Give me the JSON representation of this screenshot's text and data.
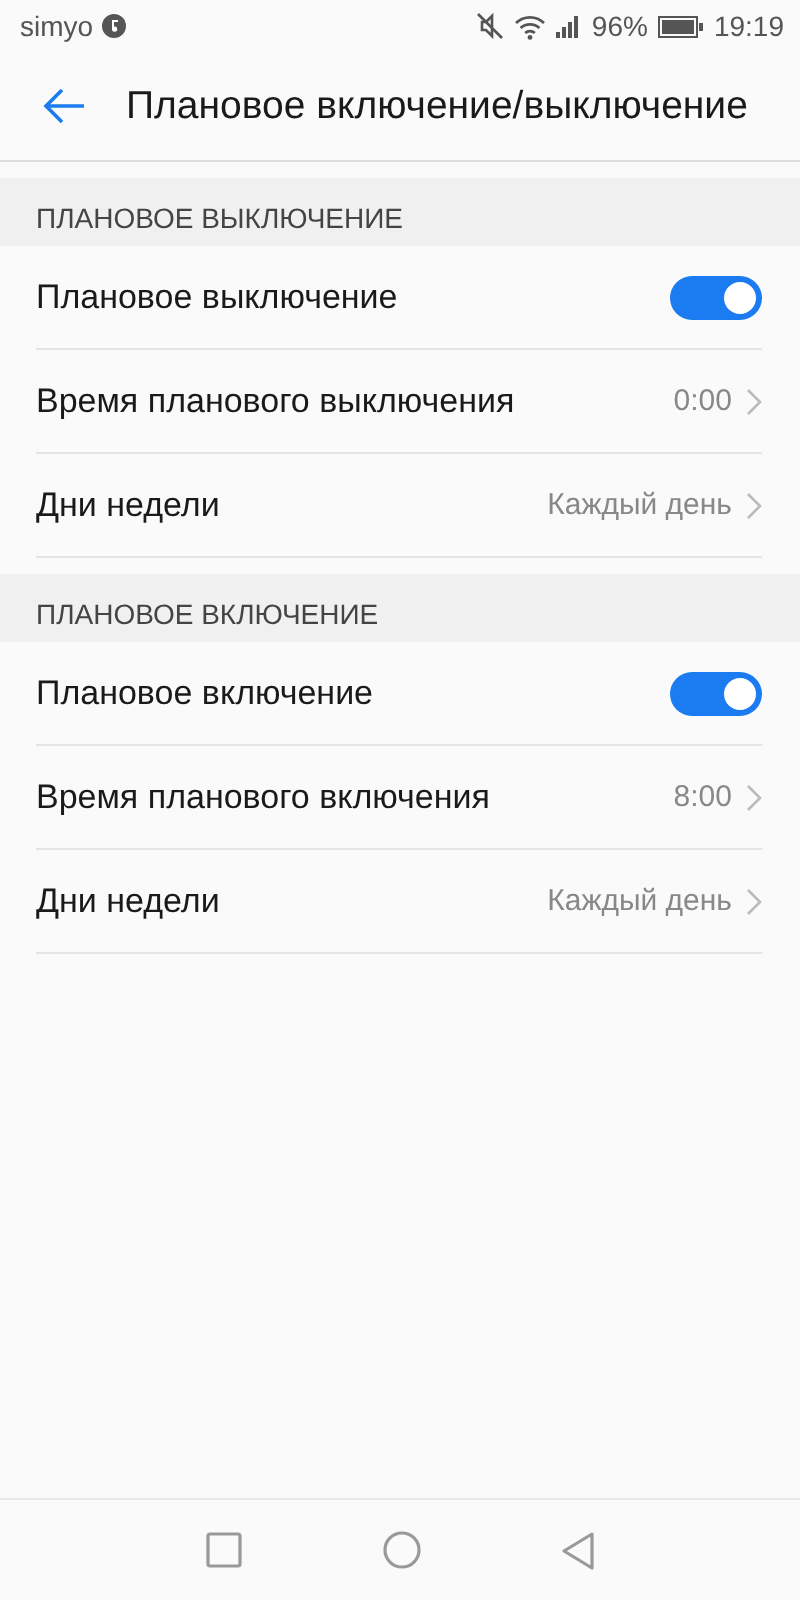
{
  "status_bar": {
    "carrier": "simyo",
    "battery": "96%",
    "time": "19:19"
  },
  "header": {
    "title": "Плановое включение/выключение"
  },
  "sections": [
    {
      "title": "ПЛАНОВОЕ ВЫКЛЮЧЕНИЕ",
      "items": [
        {
          "kind": "toggle",
          "label": "Плановое выключение",
          "on": true
        },
        {
          "kind": "link",
          "label": "Время планового выключения",
          "value": "0:00"
        },
        {
          "kind": "link",
          "label": "Дни недели",
          "value": "Каждый день"
        }
      ]
    },
    {
      "title": "ПЛАНОВОЕ ВКЛЮЧЕНИЕ",
      "items": [
        {
          "kind": "toggle",
          "label": "Плановое включение",
          "on": true
        },
        {
          "kind": "link",
          "label": "Время планового включения",
          "value": "8:00"
        },
        {
          "kind": "link",
          "label": "Дни недели",
          "value": "Каждый день"
        }
      ]
    }
  ]
}
